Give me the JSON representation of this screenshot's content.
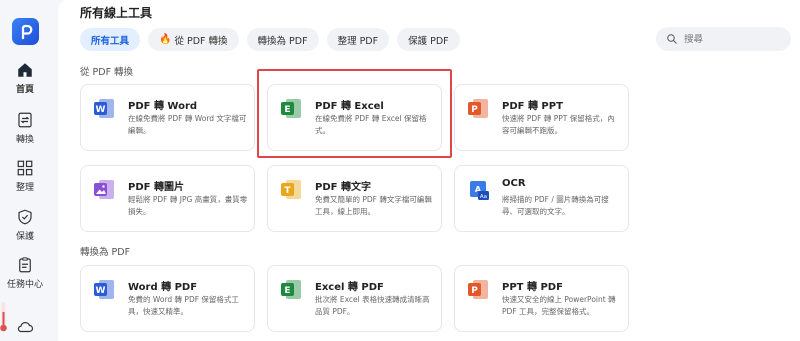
{
  "sidebar": {
    "items": [
      {
        "label": "首頁",
        "icon": "home-icon"
      },
      {
        "label": "轉換",
        "icon": "convert-icon"
      },
      {
        "label": "整理",
        "icon": "grid-icon"
      },
      {
        "label": "保護",
        "icon": "shield-icon"
      },
      {
        "label": "任務中心",
        "icon": "task-icon"
      },
      {
        "label": "",
        "icon": "cloud-icon"
      }
    ]
  },
  "main": {
    "heading": "所有線上工具",
    "tabs": [
      {
        "label": "所有工具"
      },
      {
        "label": "從 PDF 轉換",
        "icon": "flame-icon"
      },
      {
        "label": "轉換為 PDF"
      },
      {
        "label": "整理 PDF"
      },
      {
        "label": "保護 PDF"
      }
    ],
    "search": {
      "placeholder": "搜尋"
    },
    "sections": [
      {
        "label": "從 PDF 轉換",
        "cards": [
          {
            "title": "PDF 轉 Word",
            "desc": "在線免費將 PDF 轉 Word 文字檔可編輯。",
            "icon": "word-icon",
            "color": "#2b5cd6"
          },
          {
            "title": "PDF 轉 Excel",
            "desc": "在線免費將 PDF 轉 Excel 保留格式。",
            "icon": "excel-icon",
            "color": "#1e8a3f"
          },
          {
            "title": "PDF 轉 PPT",
            "desc": "快速將 PDF 轉 PPT 保留格式，內容可編輯不跑版。",
            "icon": "ppt-icon",
            "color": "#e2572b"
          },
          {
            "title": "PDF 轉圖片",
            "desc": "輕鬆將 PDF 轉 JPG 高畫質，畫質零損失。",
            "icon": "image-icon",
            "color": "#8b4fd6"
          },
          {
            "title": "PDF 轉文字",
            "desc": "免費又簡單的 PDF 轉文字檔可編輯工具，線上即用。",
            "icon": "text-icon",
            "color": "#e8a81e"
          },
          {
            "title": "OCR",
            "desc": "將掃描的 PDF / 圖片轉換為可搜尋、可選取的文字。",
            "icon": "ocr-icon",
            "color": "#3b7be8"
          }
        ]
      },
      {
        "label": "轉換為 PDF",
        "cards": [
          {
            "title": "Word 轉 PDF",
            "desc": "免費的 Word 轉 PDF 保留格式工具，快速又精準。",
            "icon": "word-icon",
            "color": "#2b5cd6"
          },
          {
            "title": "Excel 轉 PDF",
            "desc": "批次將 Excel 表格快速轉成清晰高品質 PDF。",
            "icon": "excel-icon",
            "color": "#1e8a3f"
          },
          {
            "title": "PPT 轉 PDF",
            "desc": "快速又安全的線上 PowerPoint 轉 PDF 工具，完整保留格式。",
            "icon": "ppt-icon",
            "color": "#e2572b"
          }
        ]
      }
    ]
  }
}
